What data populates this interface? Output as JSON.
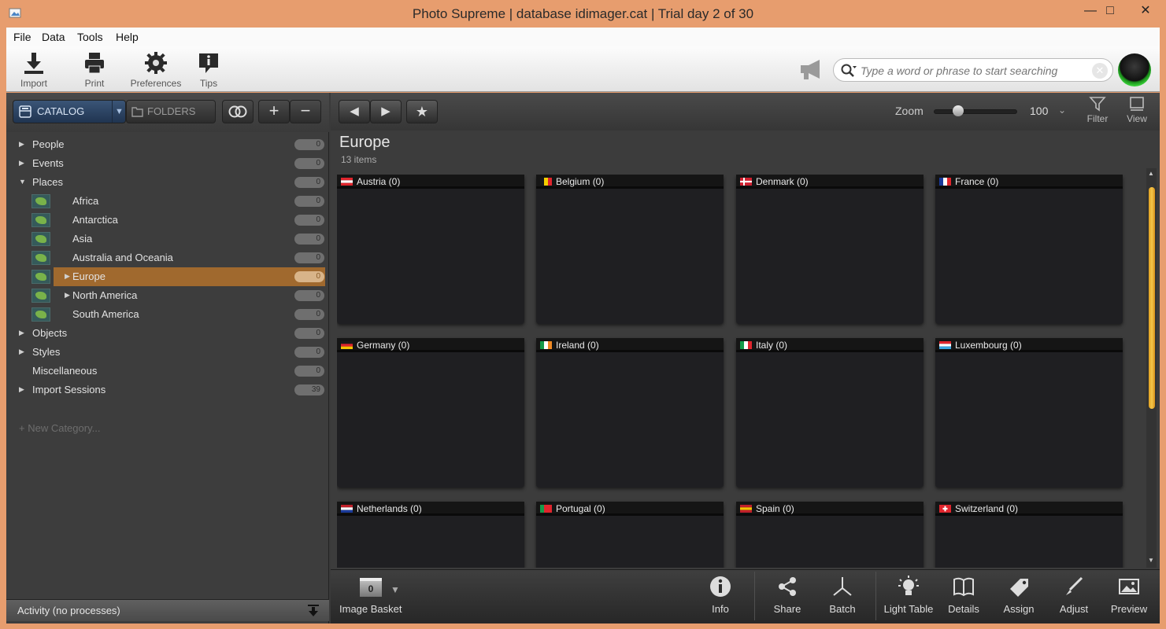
{
  "window": {
    "title": "Photo Supreme | database idimager.cat | Trial day 2 of 30",
    "minimize": "—",
    "maximize": "□",
    "close": "✕"
  },
  "menu": [
    "File",
    "Data",
    "Tools",
    "Help"
  ],
  "toolbar": {
    "tools": [
      {
        "label": "Import",
        "icon": "import-icon"
      },
      {
        "label": "Print",
        "icon": "print-icon"
      },
      {
        "label": "Preferences",
        "icon": "gear-icon"
      },
      {
        "label": "Tips",
        "icon": "tips-icon"
      }
    ],
    "search_placeholder": "Type a word or phrase to start searching",
    "search_clear": "✕"
  },
  "left": {
    "catalog_label": "CATALOG",
    "catalog_dropdown": "▼",
    "folders_label": "FOLDERS",
    "add": "+",
    "remove": "−",
    "tree": [
      {
        "label": "People",
        "count": "0",
        "arrow": "▶",
        "level": 0
      },
      {
        "label": "Events",
        "count": "0",
        "arrow": "▶",
        "level": 0
      },
      {
        "label": "Places",
        "count": "0",
        "arrow": "▼",
        "level": 0
      },
      {
        "label": "Africa",
        "count": "0",
        "arrow": "",
        "level": 1
      },
      {
        "label": "Antarctica",
        "count": "0",
        "arrow": "",
        "level": 1
      },
      {
        "label": "Asia",
        "count": "0",
        "arrow": "",
        "level": 1
      },
      {
        "label": "Australia and Oceania",
        "count": "0",
        "arrow": "",
        "level": 1
      },
      {
        "label": "Europe",
        "count": "0",
        "arrow": "▶",
        "level": 1,
        "selected": true
      },
      {
        "label": "North America",
        "count": "0",
        "arrow": "▶",
        "level": 1
      },
      {
        "label": "South America",
        "count": "0",
        "arrow": "",
        "level": 1
      },
      {
        "label": "Objects",
        "count": "0",
        "arrow": "▶",
        "level": 0
      },
      {
        "label": "Styles",
        "count": "0",
        "arrow": "▶",
        "level": 0
      },
      {
        "label": "Miscellaneous",
        "count": "0",
        "arrow": "",
        "level": 0
      },
      {
        "label": "Import Sessions",
        "count": "39",
        "arrow": "▶",
        "level": 0
      }
    ],
    "new_category": "+ New Category...",
    "activity": "Activity (no processes)"
  },
  "right": {
    "nav_back": "◀",
    "nav_forward": "▶",
    "favorite": "★",
    "zoom_label": "Zoom",
    "zoom_value": "100",
    "zoom_level": 0.25,
    "zoom_dropdown": "⌄",
    "filter_label": "Filter",
    "view_label": "View",
    "place_title": "Europe",
    "place_count": "13 items",
    "cards": [
      {
        "name": "Austria (0)",
        "flag": [
          "#e0252d",
          "#ffffff",
          "#e0252d"
        ],
        "dir": "h"
      },
      {
        "name": "Belgium (0)",
        "flag": [
          "#1a1a1a",
          "#f5d000",
          "#e0252d"
        ],
        "dir": "v"
      },
      {
        "name": "Denmark (0)",
        "flag": [
          "#d02030",
          "#ffffff"
        ],
        "dir": "cross"
      },
      {
        "name": "France (0)",
        "flag": [
          "#1a3a9a",
          "#ffffff",
          "#e0252d"
        ],
        "dir": "v"
      },
      {
        "name": "Germany (0)",
        "flag": [
          "#1a1a1a",
          "#e0252d",
          "#f5c400"
        ],
        "dir": "h"
      },
      {
        "name": "Ireland (0)",
        "flag": [
          "#159a4a",
          "#ffffff",
          "#f08a24"
        ],
        "dir": "v"
      },
      {
        "name": "Italy (0)",
        "flag": [
          "#159a4a",
          "#ffffff",
          "#e0252d"
        ],
        "dir": "v"
      },
      {
        "name": "Luxembourg (0)",
        "flag": [
          "#e0252d",
          "#ffffff",
          "#3aa4e0"
        ],
        "dir": "h"
      },
      {
        "name": "Netherlands (0)",
        "flag": [
          "#c0202a",
          "#ffffff",
          "#1a3a9a"
        ],
        "dir": "h"
      },
      {
        "name": "Portugal (0)",
        "flag": [
          "#159a4a",
          "#e0252d",
          "#e0252d"
        ],
        "dir": "v"
      },
      {
        "name": "Spain (0)",
        "flag": [
          "#c0202a",
          "#f5c400",
          "#c0202a"
        ],
        "dir": "h"
      },
      {
        "name": "Switzerland (0)",
        "flag": [
          "#e0252d",
          "#ffffff"
        ],
        "dir": "swiss"
      }
    ],
    "basket_count": "0",
    "basket_dropdown": "▼",
    "basket_label": "Image Basket",
    "bottom_tools": [
      {
        "label": "Info",
        "icon": "info-icon"
      },
      {
        "label": "Share",
        "icon": "share-icon"
      },
      {
        "label": "Batch",
        "icon": "batch-icon"
      },
      {
        "label": "Light Table",
        "icon": "light-table-icon"
      },
      {
        "label": "Details",
        "icon": "details-icon"
      },
      {
        "label": "Assign",
        "icon": "assign-icon"
      },
      {
        "label": "Adjust",
        "icon": "adjust-icon"
      },
      {
        "label": "Preview",
        "icon": "preview-icon"
      }
    ]
  }
}
